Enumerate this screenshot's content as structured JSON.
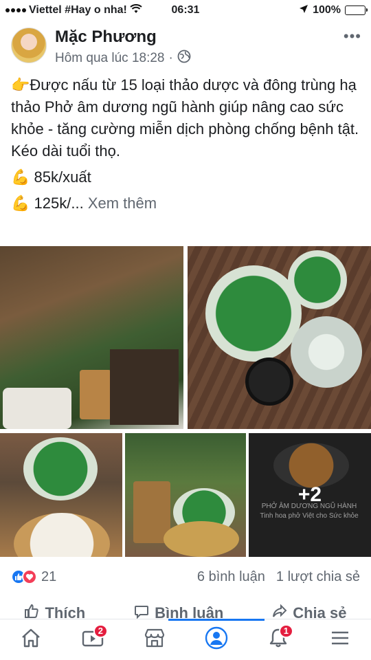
{
  "status_bar": {
    "carrier": "Viettel #Hay o nha!",
    "time": "06:31",
    "battery": "100%",
    "battery_level": 1.0
  },
  "post": {
    "author": "Mặc Phương",
    "timestamp": "Hôm qua lúc 18:28",
    "separator": "·",
    "privacy_icon": "globe-icon",
    "text_main": "Được nấu từ 15 loại thảo dược và đông trùng hạ thảo Phở âm dương ngũ hành giúp nâng cao sức khỏe - tăng cường miễn dịch phòng chống bệnh tật. Kéo dài tuổi thọ.",
    "price_1": "85k/xuất",
    "price_2_prefix": "125k/...",
    "see_more": "Xem thêm",
    "emoji_pointing": "👉",
    "emoji_muscle": "💪"
  },
  "gallery": {
    "more_count": "+2",
    "card_text_1": "PHỞ ÂM DƯƠNG NGŨ HÀNH",
    "card_text_2": "Tinh hoa phở Việt cho Sức khỏe"
  },
  "reactions": {
    "count": "21",
    "comments": "6 bình luận",
    "shares": "1 lượt chia sẻ"
  },
  "actions": {
    "like": "Thích",
    "comment": "Bình luận",
    "share": "Chia sẻ"
  },
  "tabbar": {
    "watch_badge": "2",
    "notifications_badge": "1"
  },
  "colors": {
    "accent": "#1877f2",
    "badge": "#e41e3f",
    "secondary_text": "#606770"
  }
}
